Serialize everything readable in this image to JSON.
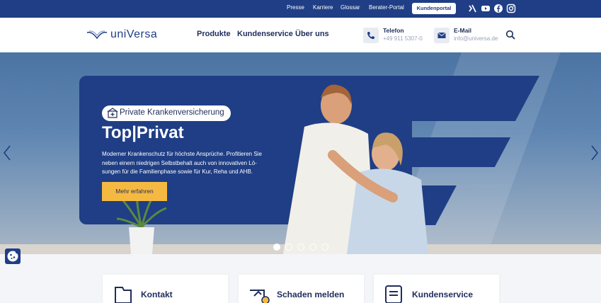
{
  "topbar": {
    "links": [
      "Presse",
      "Karriere",
      "Glossar",
      "Berater-Portal"
    ],
    "portal_button": "Kundenportal",
    "social_icons": [
      "xing-icon",
      "youtube-icon",
      "facebook-icon",
      "instagram-icon"
    ]
  },
  "header": {
    "logo_text": "uniVersa",
    "nav": [
      "Produkte",
      "Kundenservice",
      "Über uns"
    ],
    "phone": {
      "title": "Telefon",
      "value": "+49 911 5307-0"
    },
    "email": {
      "title": "E-Mail",
      "value": "info@universa.de"
    }
  },
  "hero": {
    "badge": "Private Krankenversicherung",
    "title": "Top|Privat",
    "text": "Moderner Krankenschutz für höchste Ansprüche. Profitieren Sie neben einem niedrigen Selbstbehalt auch von innovativen Lö-sungen für die Familienphase sowie für Kur, Reha und AHB.",
    "cta": "Mehr erfahren",
    "slides_total": 5,
    "slide_active": 1
  },
  "cards": [
    {
      "title": "Kontakt",
      "icon": "contact-icon"
    },
    {
      "title": "Schaden melden",
      "icon": "damage-report-icon"
    },
    {
      "title": "Kundenservice",
      "icon": "customer-service-icon"
    }
  ],
  "colors": {
    "brand_blue": "#1f3e85",
    "accent_yellow": "#f5b942"
  }
}
